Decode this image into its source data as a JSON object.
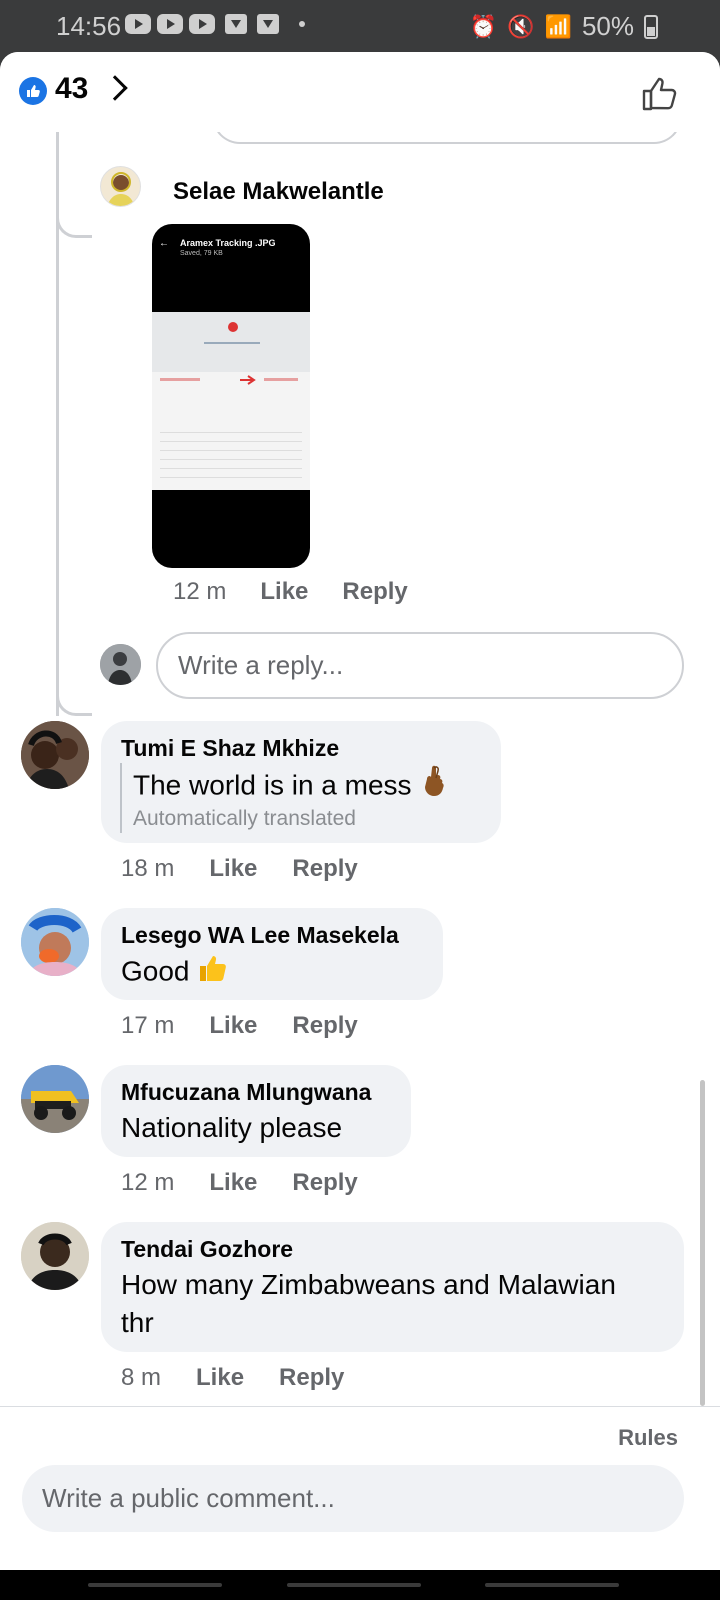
{
  "status_bar": {
    "time": "14:56",
    "battery": "50%"
  },
  "header": {
    "reaction_count": "43"
  },
  "thread_reply": {
    "author": "Selae Makwelantle",
    "attachment": {
      "title": "Aramex Tracking .JPG",
      "subtitle": "Saved, 79 KB"
    },
    "time": "12 m",
    "like_label": "Like",
    "reply_label": "Reply"
  },
  "reply_input": {
    "placeholder": "Write a reply..."
  },
  "comments": [
    {
      "author": "Tumi E Shaz Mkhize",
      "text": "The world is in a mess",
      "note": "Automatically translated",
      "time": "18 m",
      "like_label": "Like",
      "reply_label": "Reply"
    },
    {
      "author": "Lesego WA Lee Masekela",
      "text": "Good",
      "time": "17 m",
      "like_label": "Like",
      "reply_label": "Reply"
    },
    {
      "author": "Mfucuzana Mlungwana",
      "text": "Nationality please",
      "time": "12 m",
      "like_label": "Like",
      "reply_label": "Reply"
    },
    {
      "author": "Tendai Gozhore",
      "text_line1": "How many Zimbabweans and Malawian",
      "text_line2": "thr",
      "time": "8 m",
      "like_label": "Like",
      "reply_label": "Reply"
    }
  ],
  "composer": {
    "rules_label": "Rules",
    "placeholder": "Write a public comment..."
  },
  "colors": {
    "accent": "#1b74e4",
    "bubble": "#f0f2f5",
    "muted_text": "#65676b"
  }
}
